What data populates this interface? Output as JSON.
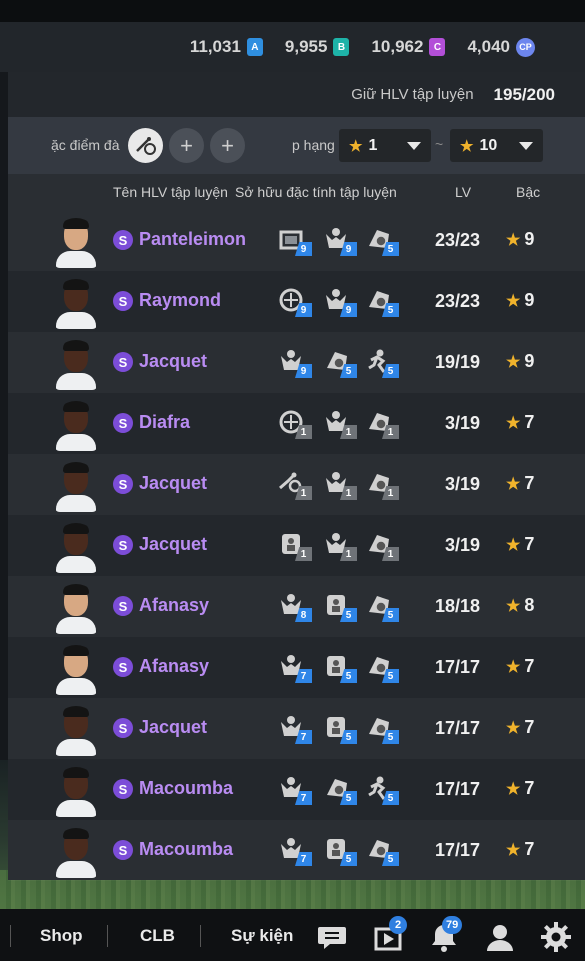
{
  "currencies": [
    {
      "value": "11,031",
      "tag": "A",
      "color": "#2f8fe0"
    },
    {
      "value": "9,955",
      "tag": "B",
      "color": "#1eb3a8"
    },
    {
      "value": "10,962",
      "tag": "C",
      "color": "#b34fd8"
    },
    {
      "value": "4,040",
      "tag": "CP",
      "color": "#6d86ee"
    }
  ],
  "keep": {
    "label": "Giữ HLV tập luyện",
    "value": "195/200"
  },
  "filter": {
    "trait_label": "ặc điểm đà",
    "rank_label": "p hạng",
    "rank_min": "1",
    "rank_max": "10",
    "separator": "~"
  },
  "header": {
    "name_col": "Tên HLV tập luyện",
    "traits_col": "Sở hữu đặc tính tập luyện",
    "lv_col": "LV",
    "grade_col": "Bậc"
  },
  "rows": [
    {
      "name": "Panteleimon",
      "skin": "light",
      "lv": "23/23",
      "grade": "9",
      "traits": [
        {
          "icon": "gate-icon",
          "level": "9",
          "color": "blue"
        },
        {
          "icon": "person-icon",
          "level": "9",
          "color": "blue"
        },
        {
          "icon": "ball-icon",
          "level": "5",
          "color": "blue"
        }
      ]
    },
    {
      "name": "Raymond",
      "skin": "dark",
      "lv": "23/23",
      "grade": "9",
      "traits": [
        {
          "icon": "target-icon",
          "level": "9",
          "color": "blue"
        },
        {
          "icon": "person-icon",
          "level": "9",
          "color": "blue"
        },
        {
          "icon": "ball-icon",
          "level": "5",
          "color": "blue"
        }
      ]
    },
    {
      "name": "Jacquet",
      "skin": "dark",
      "lv": "19/19",
      "grade": "9",
      "traits": [
        {
          "icon": "person-icon",
          "level": "9",
          "color": "blue"
        },
        {
          "icon": "ball-icon",
          "level": "5",
          "color": "blue"
        },
        {
          "icon": "runner-icon",
          "level": "5",
          "color": "blue"
        }
      ]
    },
    {
      "name": "Diafra",
      "skin": "dark",
      "lv": "3/19",
      "grade": "7",
      "traits": [
        {
          "icon": "target-icon",
          "level": "1",
          "color": "gray"
        },
        {
          "icon": "person-icon",
          "level": "1",
          "color": "gray"
        },
        {
          "icon": "ball-icon",
          "level": "1",
          "color": "gray"
        }
      ]
    },
    {
      "name": "Jacquet",
      "skin": "dark",
      "lv": "3/19",
      "grade": "7",
      "traits": [
        {
          "icon": "tackle-icon",
          "level": "1",
          "color": "gray"
        },
        {
          "icon": "person-icon",
          "level": "1",
          "color": "gray"
        },
        {
          "icon": "ball-icon",
          "level": "1",
          "color": "gray"
        }
      ]
    },
    {
      "name": "Jacquet",
      "skin": "dark",
      "lv": "3/19",
      "grade": "7",
      "traits": [
        {
          "icon": "lock-icon",
          "level": "1",
          "color": "gray"
        },
        {
          "icon": "person-icon",
          "level": "1",
          "color": "gray"
        },
        {
          "icon": "ball-icon",
          "level": "1",
          "color": "gray"
        }
      ]
    },
    {
      "name": "Afanasy",
      "skin": "light",
      "lv": "18/18",
      "grade": "8",
      "traits": [
        {
          "icon": "person-icon",
          "level": "8",
          "color": "blue"
        },
        {
          "icon": "lock-icon",
          "level": "5",
          "color": "blue"
        },
        {
          "icon": "ball-icon",
          "level": "5",
          "color": "blue"
        }
      ]
    },
    {
      "name": "Afanasy",
      "skin": "light",
      "lv": "17/17",
      "grade": "7",
      "traits": [
        {
          "icon": "person-icon",
          "level": "7",
          "color": "blue"
        },
        {
          "icon": "lock-icon",
          "level": "5",
          "color": "blue"
        },
        {
          "icon": "ball-icon",
          "level": "5",
          "color": "blue"
        }
      ]
    },
    {
      "name": "Jacquet",
      "skin": "dark",
      "lv": "17/17",
      "grade": "7",
      "traits": [
        {
          "icon": "person-icon",
          "level": "7",
          "color": "blue"
        },
        {
          "icon": "lock-icon",
          "level": "5",
          "color": "blue"
        },
        {
          "icon": "ball-icon",
          "level": "5",
          "color": "blue"
        }
      ]
    },
    {
      "name": "Macoumba",
      "skin": "dark",
      "lv": "17/17",
      "grade": "7",
      "traits": [
        {
          "icon": "person-icon",
          "level": "7",
          "color": "blue"
        },
        {
          "icon": "ball-icon",
          "level": "5",
          "color": "blue"
        },
        {
          "icon": "runner-icon",
          "level": "5",
          "color": "blue"
        }
      ]
    },
    {
      "name": "Macoumba",
      "skin": "dark",
      "lv": "17/17",
      "grade": "7",
      "traits": [
        {
          "icon": "person-icon",
          "level": "7",
          "color": "blue"
        },
        {
          "icon": "lock-icon",
          "level": "5",
          "color": "blue"
        },
        {
          "icon": "ball-icon",
          "level": "5",
          "color": "blue"
        }
      ]
    }
  ],
  "nav": {
    "shop": "Shop",
    "clb": "CLB",
    "events": "Sự kiện",
    "play_badge": "2",
    "notif_badge": "79"
  }
}
